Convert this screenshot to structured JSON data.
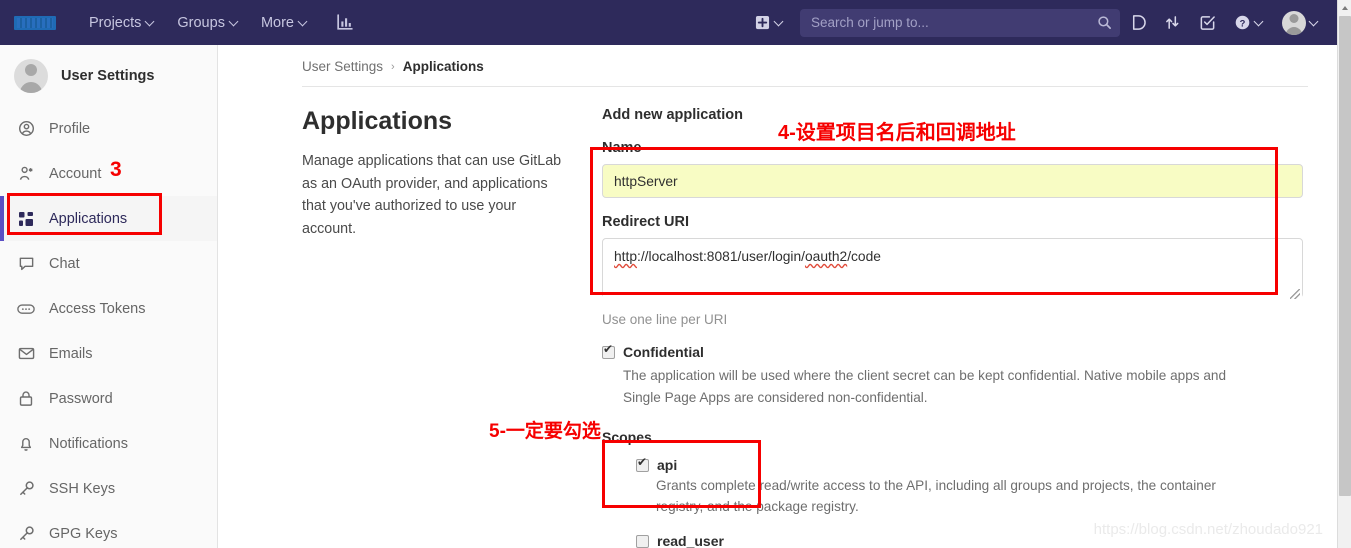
{
  "navbar": {
    "logo_alt": "gitlab-logo",
    "items": [
      {
        "label": "Projects",
        "icon": "chevron-down-icon"
      },
      {
        "label": "Groups",
        "icon": "chevron-down-icon"
      },
      {
        "label": "More",
        "icon": "chevron-down-icon"
      }
    ],
    "analytics_icon": "bar-chart-icon",
    "plus_icon": "plus-square-icon",
    "search": {
      "value": "",
      "placeholder": "Search or jump to...",
      "icon": "search-icon"
    },
    "right_icons": [
      {
        "name": "issues-icon"
      },
      {
        "name": "merge-requests-icon"
      },
      {
        "name": "todos-icon"
      },
      {
        "name": "help-icon"
      },
      {
        "name": "user-avatar"
      }
    ],
    "bg_color": "#2e2a5b"
  },
  "sidebar": {
    "title": "User Settings",
    "avatar": "user-avatar",
    "items": [
      {
        "label": "Profile",
        "icon": "user-circle-icon",
        "active": false
      },
      {
        "label": "Account",
        "icon": "account-icon",
        "active": false
      },
      {
        "label": "Applications",
        "icon": "applications-grid-icon",
        "active": true
      },
      {
        "label": "Chat",
        "icon": "chat-bubble-icon",
        "active": false
      },
      {
        "label": "Access Tokens",
        "icon": "token-icon",
        "active": false
      },
      {
        "label": "Emails",
        "icon": "envelope-icon",
        "active": false
      },
      {
        "label": "Password",
        "icon": "lock-icon",
        "active": false
      },
      {
        "label": "Notifications",
        "icon": "bell-icon",
        "active": false
      },
      {
        "label": "SSH Keys",
        "icon": "key-icon",
        "active": false
      },
      {
        "label": "GPG Keys",
        "icon": "key-icon",
        "active": false
      }
    ],
    "active_accent_color": "#5b4fc4"
  },
  "breadcrumb": {
    "parent": "User Settings",
    "separator": "›",
    "current": "Applications"
  },
  "main": {
    "heading": "Applications",
    "description": "Manage applications that can use GitLab as an OAuth provider, and applications that you've authorized to use your account."
  },
  "form": {
    "title": "Add new application",
    "name_label": "Name",
    "name_value": "httpServer",
    "redirect_label": "Redirect URI",
    "redirect_value": "http://localhost:8081/user/login/oauth2/code",
    "redirect_help": "Use one line per URI",
    "confidential": {
      "label": "Confidential",
      "checked": true,
      "description": "The application will be used where the client secret can be kept confidential. Native mobile apps and Single Page Apps are considered non-confidential."
    },
    "scopes_label": "Scopes",
    "scopes": [
      {
        "name": "api",
        "checked": true,
        "description": "Grants complete read/write access to the API, including all groups and projects, the container registry, and the package registry."
      },
      {
        "name": "read_user",
        "checked": false,
        "description": ""
      }
    ]
  },
  "annotations": {
    "color": "#f60000",
    "step3": "3",
    "step4": "4-设置项目名后和回调地址",
    "step5": "5-一定要勾选"
  },
  "watermark": "https://blog.csdn.net/zhoudado921"
}
